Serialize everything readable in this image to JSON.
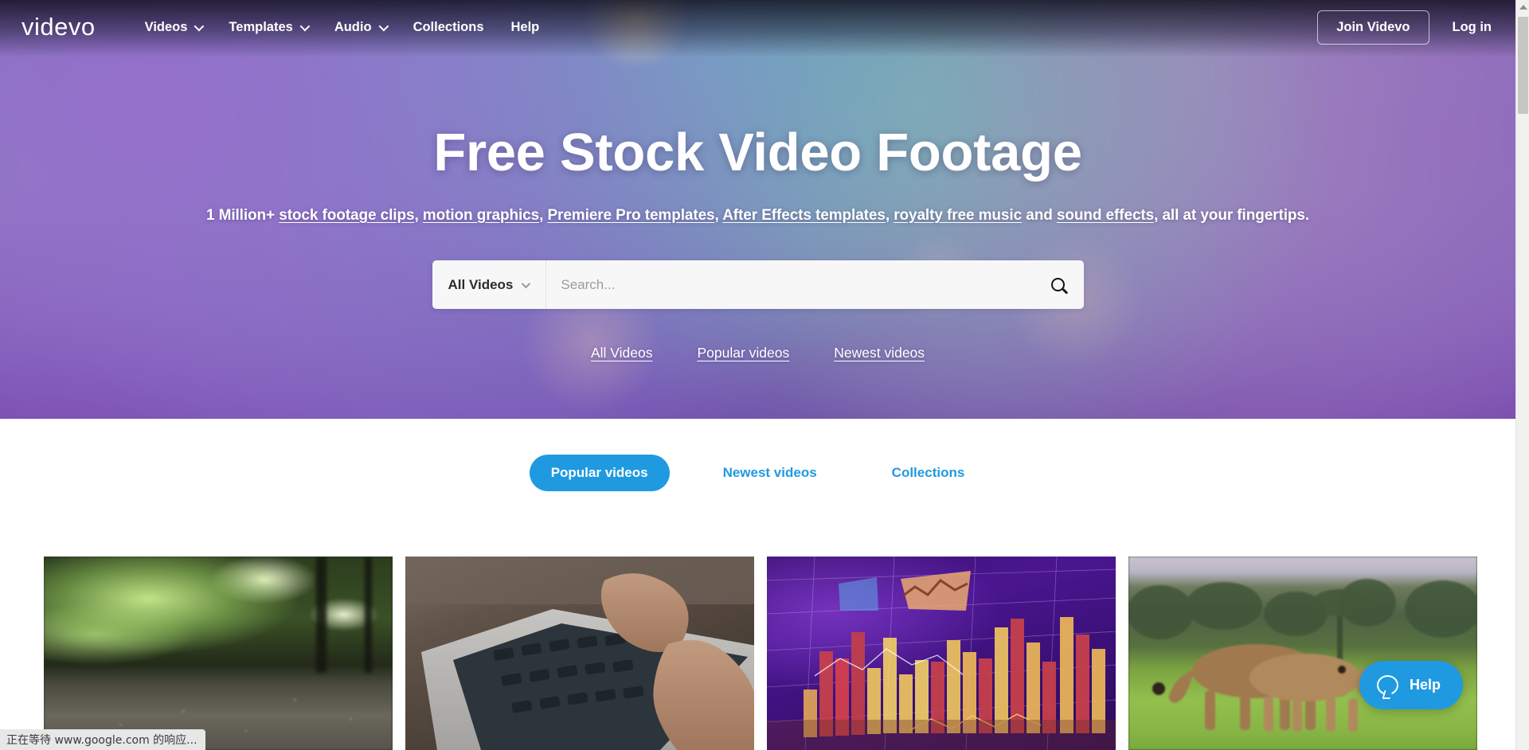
{
  "brand": {
    "name": "videvo"
  },
  "nav": {
    "items": [
      {
        "label": "Videos",
        "has_caret": true,
        "icon": "chevron-down-icon"
      },
      {
        "label": "Templates",
        "has_caret": true,
        "icon": "chevron-down-icon"
      },
      {
        "label": "Audio",
        "has_caret": true,
        "icon": "chevron-down-icon"
      },
      {
        "label": "Collections",
        "has_caret": false
      },
      {
        "label": "Help",
        "has_caret": false
      }
    ],
    "join_label": "Join Videvo",
    "login_label": "Log in"
  },
  "hero": {
    "title": "Free Stock Video Footage",
    "subtitle": {
      "prefix": "1 Million+ ",
      "links": [
        "stock footage clips",
        "motion graphics",
        "Premiere Pro templates",
        "After Effects templates",
        "royalty free music",
        "sound effects"
      ],
      "sep1": ", ",
      "sep2": ", ",
      "sep3": ", ",
      "sep4": ", ",
      "joiner": " and ",
      "suffix": ", all at your fingertips."
    },
    "quick_links": [
      {
        "label": "All Videos"
      },
      {
        "label": "Popular videos"
      },
      {
        "label": "Newest videos"
      }
    ]
  },
  "search": {
    "category_label": "All Videos",
    "category_icon": "chevron-down-icon",
    "placeholder": "Search...",
    "value": "",
    "button_icon": "search-icon"
  },
  "tabs": [
    {
      "label": "Popular videos",
      "active": true
    },
    {
      "label": "Newest videos",
      "active": false
    },
    {
      "label": "Collections",
      "active": false
    }
  ],
  "grid": {
    "thumbnails": [
      {
        "alt": "rain falling in a green forest"
      },
      {
        "alt": "hands typing on a laptop keyboard"
      },
      {
        "alt": "purple financial bar chart data visualization"
      },
      {
        "alt": "two lionesses walking across green savanna grass"
      }
    ]
  },
  "help_widget": {
    "label": "Help",
    "icon": "chat-bubble-icon"
  },
  "statusbar": {
    "text": "正在等待 www.google.com 的响应..."
  },
  "scrollbar": {
    "up_icon": "scroll-up-arrow-icon"
  },
  "colors": {
    "accent": "#1f9ae0",
    "hero_bottom": "#5e2a96",
    "search_bg": "#f7f7f7",
    "statusbar_bg": "#e7e7e7"
  }
}
